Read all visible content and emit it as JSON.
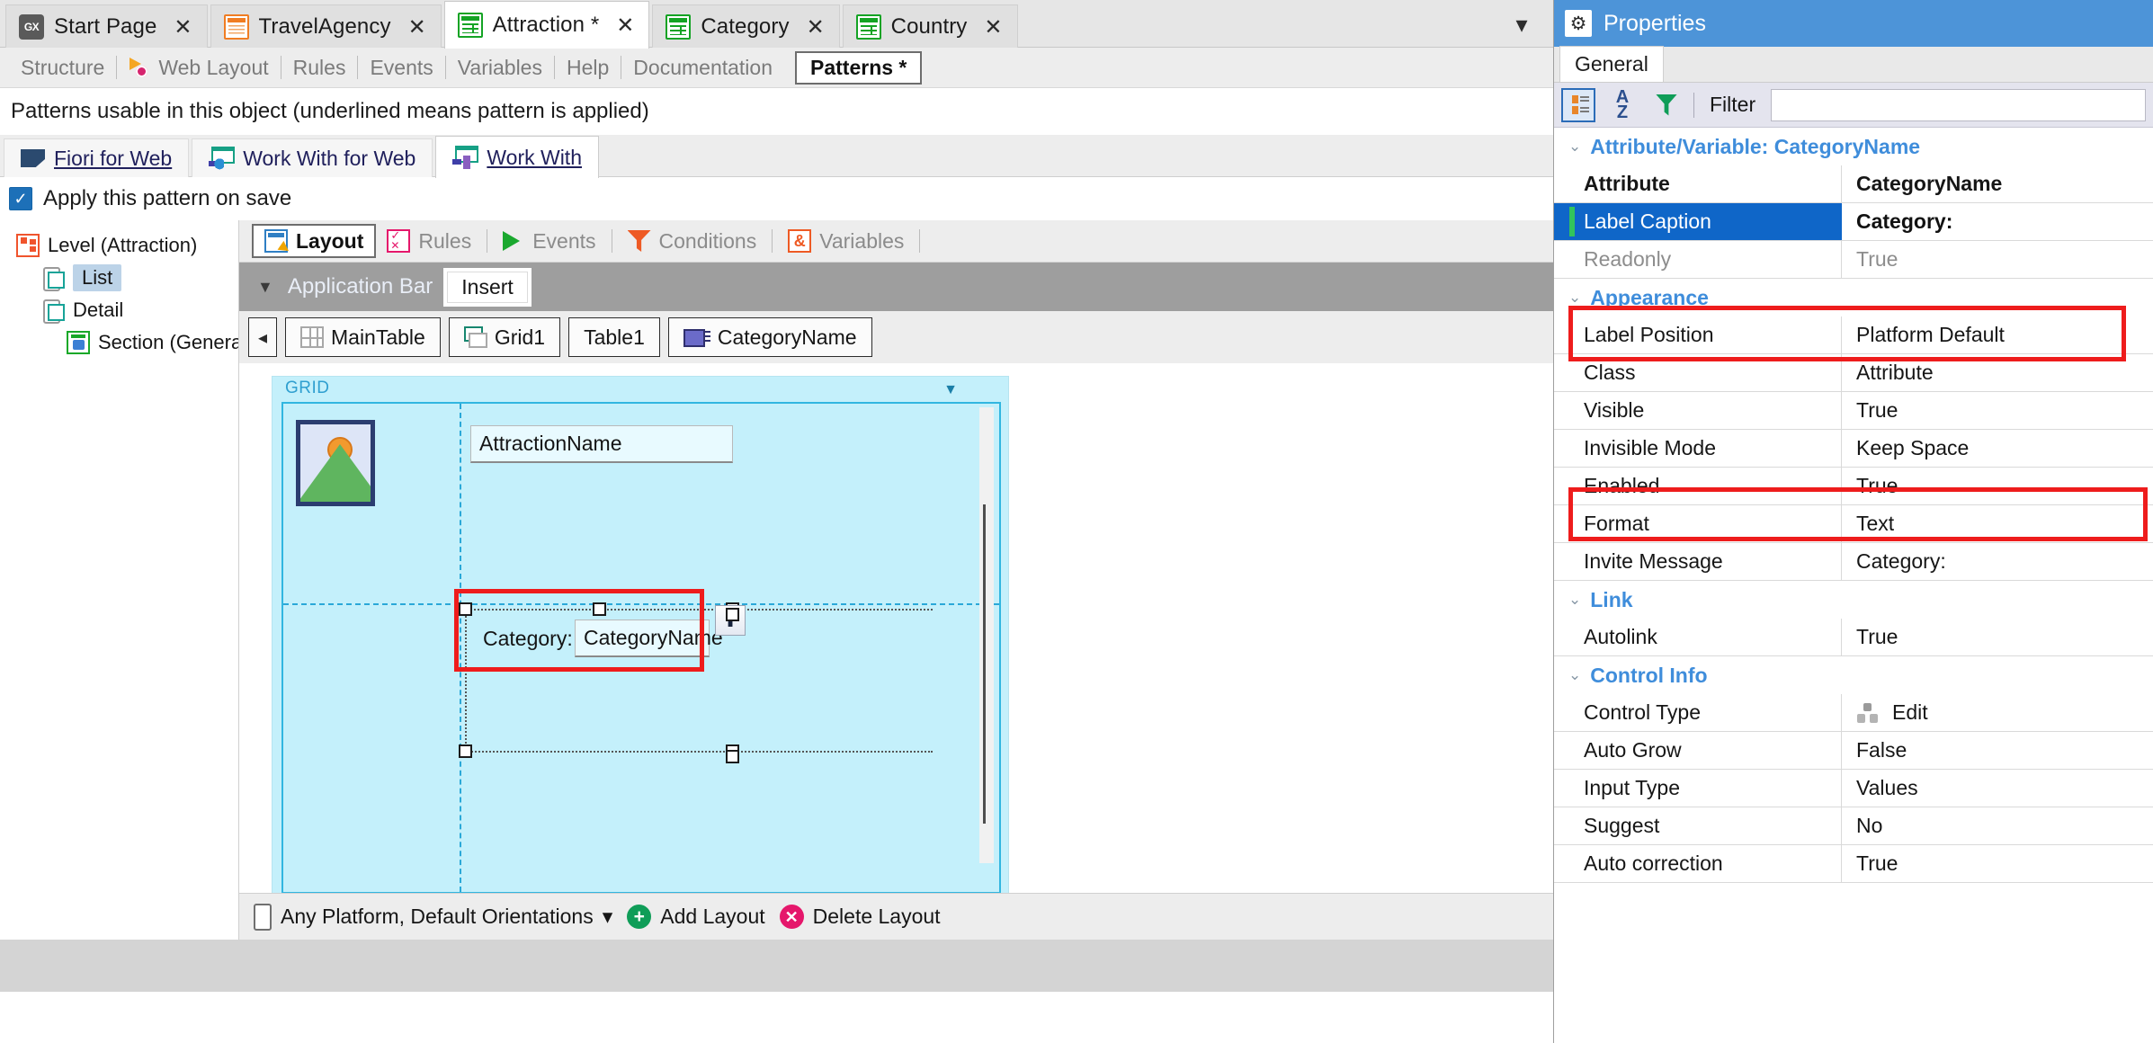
{
  "document_tabs": [
    {
      "label": "Start Page",
      "icon": "gx-logo-icon",
      "close": "✕",
      "active": false
    },
    {
      "label": "TravelAgency",
      "icon": "transaction-icon",
      "close": "✕",
      "active": false
    },
    {
      "label": "Attraction *",
      "icon": "web-panel-icon",
      "close": "✕",
      "active": true
    },
    {
      "label": "Category",
      "icon": "web-panel-icon",
      "close": "✕",
      "active": false
    },
    {
      "label": "Country",
      "icon": "web-panel-icon",
      "close": "✕",
      "active": false
    }
  ],
  "tab_overflow_icon": "chevron-down-icon",
  "object_sections": [
    {
      "label": "Structure",
      "icon": null,
      "active": false
    },
    {
      "label": "Web Layout",
      "icon": "web-layout-icon",
      "active": false
    },
    {
      "label": "Rules",
      "icon": null,
      "active": false
    },
    {
      "label": "Events",
      "icon": null,
      "active": false
    },
    {
      "label": "Variables",
      "icon": null,
      "active": false
    },
    {
      "label": "Help",
      "icon": null,
      "active": false
    },
    {
      "label": "Documentation",
      "icon": null,
      "active": false
    },
    {
      "label": "Patterns *",
      "icon": null,
      "active": true
    }
  ],
  "patterns": {
    "title": "Patterns usable in this object (underlined means pattern is applied)",
    "tabs": [
      {
        "label": "Fiori for Web",
        "icon": "fiori-icon",
        "applied": true,
        "active": false
      },
      {
        "label": "Work With for Web",
        "icon": "work-with-web-icon",
        "applied": false,
        "active": false
      },
      {
        "label": "Work With",
        "icon": "work-with-icon",
        "applied": true,
        "active": true
      }
    ],
    "apply_checkbox": {
      "label": "Apply this pattern on save",
      "checked": true,
      "check_glyph": "✓"
    }
  },
  "tree": [
    {
      "label": "Level (Attraction)",
      "icon": "level-icon",
      "level": 1,
      "selected": false
    },
    {
      "label": "List",
      "icon": "phone-list-icon",
      "level": 2,
      "selected": true
    },
    {
      "label": "Detail",
      "icon": "phone-detail-icon",
      "level": 2,
      "selected": false
    },
    {
      "label": "Section (General)",
      "icon": "section-icon",
      "level": 3,
      "selected": false
    }
  ],
  "editor": {
    "tabs": [
      {
        "label": "Layout",
        "icon": "layout-icon",
        "active": true
      },
      {
        "label": "Rules",
        "icon": "rules-icon",
        "active": false
      },
      {
        "label": "Events",
        "icon": "events-flag-icon",
        "active": false
      },
      {
        "label": "Conditions",
        "icon": "funnel-icon",
        "active": false
      },
      {
        "label": "Variables",
        "icon": "ampersand-icon",
        "active": false
      }
    ],
    "appbar": {
      "caret": "▼",
      "label": "Application Bar",
      "insert_label": "Insert"
    },
    "breadcrumb": {
      "prev_icon": "◂",
      "next_icon": "▸",
      "items": [
        {
          "label": "MainTable",
          "icon": "table-icon"
        },
        {
          "label": "Grid1",
          "icon": "grid-icon"
        },
        {
          "label": "Table1",
          "icon": null
        },
        {
          "label": "CategoryName",
          "icon": "attribute-control-icon"
        }
      ]
    },
    "canvas": {
      "grid_label": "GRID",
      "collapse_caret": "▼",
      "image_placeholder_icon": "image-placeholder-icon",
      "attraction_name_field": "AttractionName",
      "category_label": "Category:",
      "category_field": "CategoryName",
      "move_up_icon": "⬆"
    },
    "bottombar": {
      "platform_label": "Any Platform, Default Orientations",
      "platform_caret": "▾",
      "add_layout": "Add Layout",
      "delete_layout": "Delete Layout",
      "add_icon": "+",
      "delete_icon": "✕"
    }
  },
  "properties": {
    "title": "Properties",
    "gear_icon": "⚙",
    "tab": "General",
    "toolbar": {
      "categorized_icon": "categorized-list-icon",
      "alphabetical_icon": "sort-az-icon",
      "filter_icon": "funnel-icon",
      "filter_label": "Filter",
      "filter_value": ""
    },
    "groups": [
      {
        "name": "Attribute/Variable: CategoryName",
        "caret": "⌄",
        "rows": [
          {
            "key": "Attribute",
            "value": "CategoryName",
            "bold": true,
            "dim": false,
            "selected": false
          },
          {
            "key": "Label Caption",
            "value": "Category:",
            "bold": true,
            "dim": false,
            "selected": true
          },
          {
            "key": "Readonly",
            "value": "True",
            "bold": false,
            "dim": true,
            "selected": false
          }
        ]
      },
      {
        "name": "Appearance",
        "caret": "⌄",
        "rows": [
          {
            "key": "Label Position",
            "value": "Platform Default",
            "bold": false,
            "dim": false,
            "selected": false
          },
          {
            "key": "Class",
            "value": "Attribute",
            "bold": false,
            "dim": false,
            "selected": false
          },
          {
            "key": "Visible",
            "value": "True",
            "bold": false,
            "dim": false,
            "selected": false
          },
          {
            "key": "Invisible Mode",
            "value": "Keep Space",
            "bold": false,
            "dim": false,
            "selected": false
          },
          {
            "key": "Enabled",
            "value": "True",
            "bold": false,
            "dim": false,
            "selected": false
          },
          {
            "key": "Format",
            "value": "Text",
            "bold": false,
            "dim": false,
            "selected": false
          },
          {
            "key": "Invite Message",
            "value": "Category:",
            "bold": false,
            "dim": false,
            "selected": false
          }
        ]
      },
      {
        "name": "Link",
        "caret": "⌄",
        "rows": [
          {
            "key": "Autolink",
            "value": "True",
            "bold": false,
            "dim": false,
            "selected": false
          }
        ]
      },
      {
        "name": "Control Info",
        "caret": "⌄",
        "rows": [
          {
            "key": "Control Type",
            "value": "Edit",
            "icon": "control-type-icon",
            "bold": false,
            "dim": false,
            "selected": false
          },
          {
            "key": "Auto Grow",
            "value": "False",
            "bold": false,
            "dim": false,
            "selected": false
          },
          {
            "key": "Input Type",
            "value": "Values",
            "bold": false,
            "dim": false,
            "selected": false
          },
          {
            "key": "Suggest",
            "value": "No",
            "bold": false,
            "dim": false,
            "selected": false
          },
          {
            "key": "Auto correction",
            "value": "True",
            "bold": false,
            "dim": false,
            "selected": false
          }
        ]
      }
    ]
  },
  "colors": {
    "accent_blue": "#4d94d8",
    "selection_blue": "#0f66c8",
    "highlight_red": "#ee1c1c",
    "canvas_cyan": "#c4f0fb",
    "group_header_blue": "#3f8ddb"
  }
}
